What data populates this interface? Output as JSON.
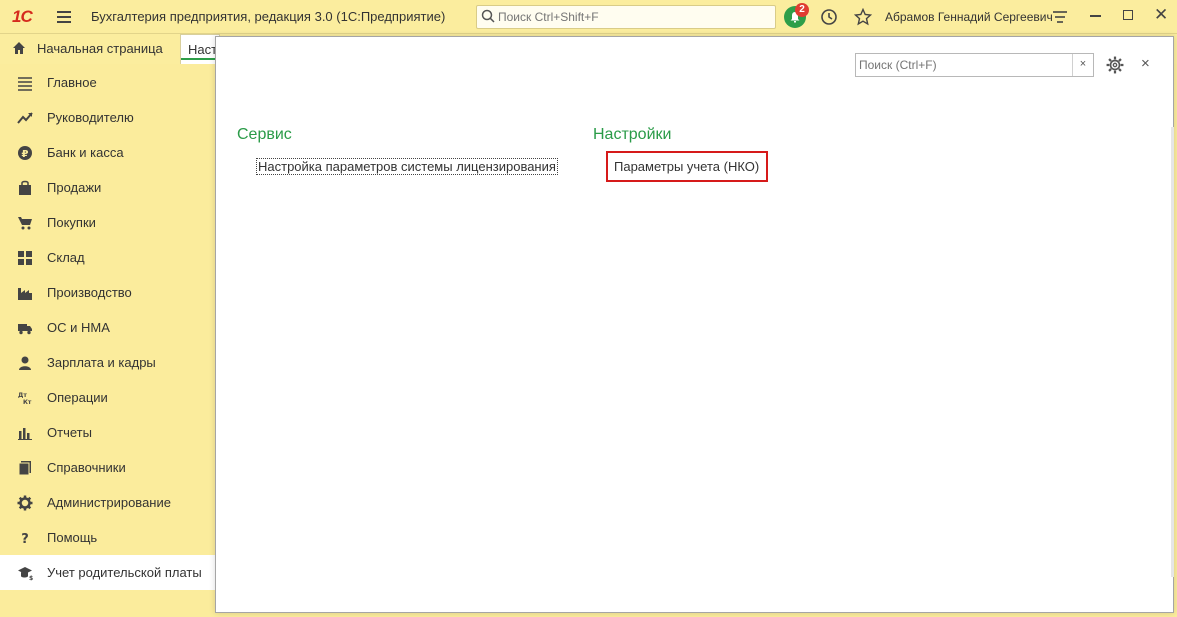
{
  "app": {
    "logo": "1С",
    "title": "Бухгалтерия предприятия, редакция 3.0  (1С:Предприятие)",
    "search_placeholder": "Поиск Ctrl+Shift+F",
    "notifications_count": "2",
    "user": "Абрамов Геннадий Сергеевич"
  },
  "tabs": {
    "home": "Начальная страница",
    "active": "Настройки"
  },
  "sidebar": {
    "items": [
      {
        "label": "Главное",
        "icon": "menu-lines-icon"
      },
      {
        "label": "Руководителю",
        "icon": "trend-icon"
      },
      {
        "label": "Банк и касса",
        "icon": "ruble-coin-icon"
      },
      {
        "label": "Продажи",
        "icon": "shopping-bag-icon"
      },
      {
        "label": "Покупки",
        "icon": "cart-icon"
      },
      {
        "label": "Склад",
        "icon": "warehouse-grid-icon"
      },
      {
        "label": "Производство",
        "icon": "factory-icon"
      },
      {
        "label": "ОС и НМА",
        "icon": "truck-icon"
      },
      {
        "label": "Зарплата и кадры",
        "icon": "person-icon"
      },
      {
        "label": "Операции",
        "icon": "dt-kt-icon"
      },
      {
        "label": "Отчеты",
        "icon": "bar-chart-icon"
      },
      {
        "label": "Справочники",
        "icon": "books-icon"
      },
      {
        "label": "Администрирование",
        "icon": "gear-icon"
      },
      {
        "label": "Помощь",
        "icon": "question-icon"
      },
      {
        "label": "Учет родительской платы",
        "icon": "graduation-cap-icon"
      }
    ]
  },
  "panel": {
    "search_placeholder": "Поиск (Ctrl+F)",
    "clear_label": "×",
    "close_label": "×",
    "sections": [
      {
        "title": "Сервис",
        "links": [
          "Настройка параметров системы лицензирования"
        ]
      },
      {
        "title": "Настройки",
        "links": [
          "Параметры учета (НКО)"
        ]
      }
    ]
  },
  "colors": {
    "sidebar_bg": "#fbec9c",
    "section_title": "#2a9b48",
    "highlight": "#d61a1a",
    "logo": "#d52b1e"
  }
}
